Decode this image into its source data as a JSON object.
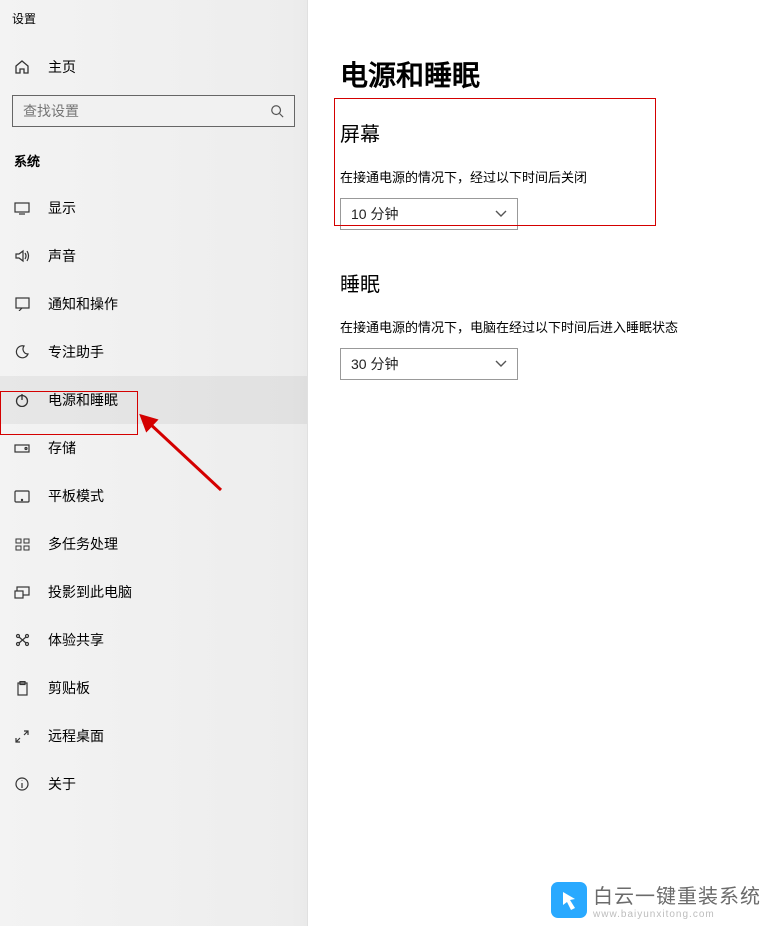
{
  "window_title": "设置",
  "home_label": "主页",
  "search_placeholder": "查找设置",
  "category_label": "系统",
  "sidebar": {
    "items": [
      {
        "label": "显示"
      },
      {
        "label": "声音"
      },
      {
        "label": "通知和操作"
      },
      {
        "label": "专注助手"
      },
      {
        "label": "电源和睡眠"
      },
      {
        "label": "存储"
      },
      {
        "label": "平板模式"
      },
      {
        "label": "多任务处理"
      },
      {
        "label": "投影到此电脑"
      },
      {
        "label": "体验共享"
      },
      {
        "label": "剪贴板"
      },
      {
        "label": "远程桌面"
      },
      {
        "label": "关于"
      }
    ]
  },
  "page_title": "电源和睡眠",
  "screen_section": {
    "title": "屏幕",
    "desc": "在接通电源的情况下，经过以下时间后关闭",
    "value": "10 分钟"
  },
  "sleep_section": {
    "title": "睡眠",
    "desc": "在接通电源的情况下，电脑在经过以下时间后进入睡眠状态",
    "value": "30 分钟"
  },
  "watermark": {
    "zh": "白云一键重装系统",
    "en": "www.baiyunxitong.com"
  }
}
